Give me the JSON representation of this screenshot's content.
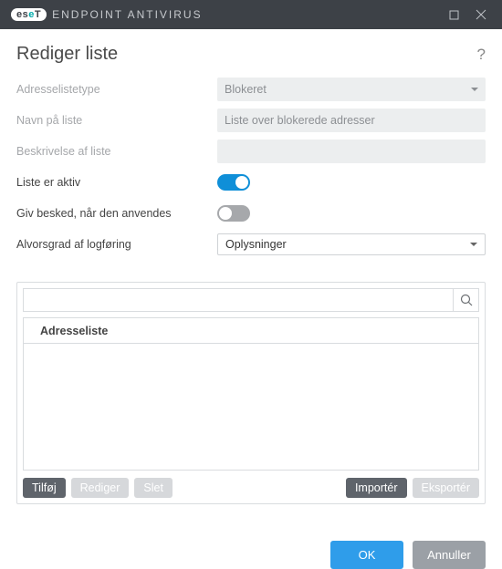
{
  "titlebar": {
    "brand_prefix": "es",
    "brand_highlight": "e",
    "brand_suffix": "T",
    "product": "ENDPOINT ANTIVIRUS"
  },
  "header": {
    "title": "Rediger liste"
  },
  "form": {
    "address_type_label": "Adresselistetype",
    "address_type_value": "Blokeret",
    "list_name_label": "Navn på liste",
    "list_name_value": "Liste over blokerede adresser",
    "list_desc_label": "Beskrivelse af liste",
    "list_desc_value": "",
    "active_label": "Liste er aktiv",
    "notify_label": "Giv besked, når den anvendes",
    "log_severity_label": "Alvorsgrad af logføring",
    "log_severity_value": "Oplysninger"
  },
  "list": {
    "column_header": "Adresseliste",
    "buttons": {
      "add": "Tilføj",
      "edit": "Rediger",
      "delete": "Slet",
      "import": "Importér",
      "export": "Eksportér"
    }
  },
  "footer": {
    "ok": "OK",
    "cancel": "Annuller"
  }
}
